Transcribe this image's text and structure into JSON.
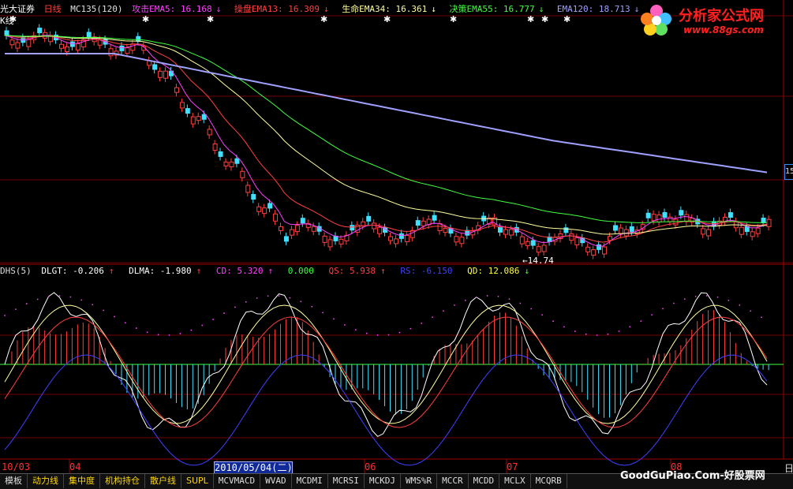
{
  "header": {
    "app": "光大证券",
    "period": "日线",
    "indicator": "MC135(120)",
    "ema": [
      {
        "label": "攻击EMA5: 16.168",
        "arrow": "↓",
        "color": "#ff40ff"
      },
      {
        "label": "操盘EMA13: 16.309",
        "arrow": "↓",
        "color": "#ff4040"
      },
      {
        "label": "生命EMA34: 16.361",
        "arrow": "↓",
        "color": "#ffffa0"
      },
      {
        "label": "决策EMA55: 16.777",
        "arrow": "↓",
        "color": "#40ff40"
      },
      {
        "label": "EMA120: 18.713",
        "arrow": "↓",
        "color": "#a0a0ff"
      }
    ],
    "sub_label": "K线"
  },
  "price": {
    "low_label": "←14.74"
  },
  "indicator_header": {
    "name": "DHS(5)",
    "items": [
      {
        "label": "DLGT: -0.206",
        "arrow": "↑",
        "color": "#ffffff"
      },
      {
        "label": "DLMA: -1.980",
        "arrow": "↑",
        "color": "#ffffff"
      },
      {
        "label": "CD: 5.320",
        "arrow": "↑",
        "color": "#ff40ff"
      },
      {
        "label": "0.000",
        "arrow": "",
        "color": "#40ff40"
      },
      {
        "label": "QS: 5.938",
        "arrow": "↑",
        "color": "#ff4040"
      },
      {
        "label": "RS: -6.150",
        "arrow": "",
        "color": "#4040ff"
      },
      {
        "label": "QD: 12.086",
        "arrow": "↓",
        "color": "#ffff40"
      }
    ]
  },
  "logo": {
    "title": "分析家公式网",
    "url": "www.88gs.com"
  },
  "axis": {
    "months": [
      {
        "label": "10/03",
        "x": 2
      },
      {
        "label": "04",
        "x": 88
      },
      {
        "label": "06",
        "x": 462
      },
      {
        "label": "07",
        "x": 642
      },
      {
        "label": "08",
        "x": 850
      }
    ],
    "cursor_date": "2010/05/04(二)",
    "right_price": "15",
    "day_label": "日"
  },
  "tabs": {
    "items": [
      {
        "label": "模板",
        "yellow": false
      },
      {
        "label": "动力线",
        "yellow": true
      },
      {
        "label": "集中度",
        "yellow": true
      },
      {
        "label": "机构持仓",
        "yellow": true
      },
      {
        "label": "散户线",
        "yellow": true
      },
      {
        "label": "SUPL",
        "yellow": true
      },
      {
        "label": "MCVMACD",
        "yellow": false
      },
      {
        "label": "WVAD",
        "yellow": false
      },
      {
        "label": "MCDMI",
        "yellow": false
      },
      {
        "label": "MCRSI",
        "yellow": false
      },
      {
        "label": "MCKDJ",
        "yellow": false
      },
      {
        "label": "WMS%R",
        "yellow": false
      },
      {
        "label": "MCCR",
        "yellow": false
      },
      {
        "label": "MCDD",
        "yellow": false
      },
      {
        "label": "MCLX",
        "yellow": false
      },
      {
        "label": "MCQRB",
        "yellow": false
      }
    ]
  },
  "watermark": "GoodGuPiao.Com-好股票网",
  "chart_data": {
    "type": "candlestick",
    "series": [
      {
        "name": "EMA5",
        "color": "#ff40ff"
      },
      {
        "name": "EMA13",
        "color": "#ff4040"
      },
      {
        "name": "EMA34",
        "color": "#ffffa0"
      },
      {
        "name": "EMA55",
        "color": "#40ff40"
      },
      {
        "name": "EMA120",
        "color": "#a0a0ff"
      }
    ],
    "low_marked": 14.74
  }
}
